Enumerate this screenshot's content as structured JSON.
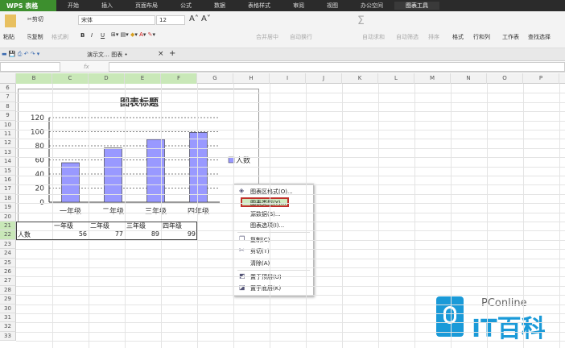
{
  "titlebar": {
    "app": "WPS 表格",
    "tabs": [
      "开始",
      "插入",
      "页面布局",
      "公式",
      "数据",
      "表格样式",
      "审阅",
      "视图",
      "办公空间",
      "图表工具"
    ]
  },
  "ribbon": {
    "paste": "粘贴",
    "cut": "剪切",
    "copy": "复制",
    "format_painter": "格式刷",
    "font": "宋体",
    "size": "12",
    "bold": "B",
    "italic": "I",
    "underline": "U",
    "merge": "合并居中",
    "wrap": "自动换行",
    "autosum": "自动求和",
    "autofilter": "自动筛选",
    "sort": "排序",
    "format": "格式",
    "rowcol": "行和列",
    "sheet": "工作表",
    "find": "查找选择"
  },
  "tabbar": {
    "doc_tab": "演示文… 图表 •",
    "close": "×",
    "add": "+"
  },
  "formula": {
    "fx": "fx"
  },
  "columns": [
    "B",
    "C",
    "D",
    "E",
    "F",
    "G",
    "H",
    "I",
    "J",
    "K",
    "L",
    "M",
    "N",
    "O",
    "P"
  ],
  "rows": [
    "6",
    "7",
    "8",
    "9",
    "10",
    "11",
    "12",
    "13",
    "14",
    "15",
    "16",
    "17",
    "18",
    "19",
    "20",
    "21",
    "22",
    "23",
    "24",
    "25",
    "26",
    "27",
    "28",
    "29",
    "30",
    "31",
    "32",
    "33"
  ],
  "table": {
    "headers": [
      "一年级",
      "二年级",
      "三年级",
      "四年级"
    ],
    "row_label": "人数",
    "values": [
      "56",
      "77",
      "89",
      "99"
    ]
  },
  "chart_data": {
    "type": "bar",
    "title": "图表标题",
    "categories": [
      "一年级",
      "二年级",
      "三年级",
      "四年级"
    ],
    "series": [
      {
        "name": "人数",
        "values": [
          56,
          77,
          89,
          99
        ]
      }
    ],
    "ylim": [
      0,
      120
    ],
    "yticks": [
      "0",
      "20",
      "40",
      "60",
      "80",
      "100",
      "120"
    ],
    "legend": "right",
    "grid": true,
    "bar_color": "#9999ff"
  },
  "context_menu": [
    {
      "label": "图表区格式(O)...",
      "icon": "format-icon"
    },
    {
      "label": "图表类型(Y)...",
      "highlighted": true
    },
    {
      "label": "源数据(S)..."
    },
    {
      "label": "图表选项(I)..."
    },
    {
      "label": "复制(C)",
      "icon": "copy-icon"
    },
    {
      "label": "剪切(T)",
      "icon": "cut-icon"
    },
    {
      "label": "清除(A)"
    },
    {
      "label": "置于顶层(U)",
      "icon": "bring-front-icon"
    },
    {
      "label": "置于底层(K)",
      "icon": "send-back-icon"
    }
  ],
  "watermark": {
    "top": "PConline",
    "bottom": "IT百科"
  }
}
